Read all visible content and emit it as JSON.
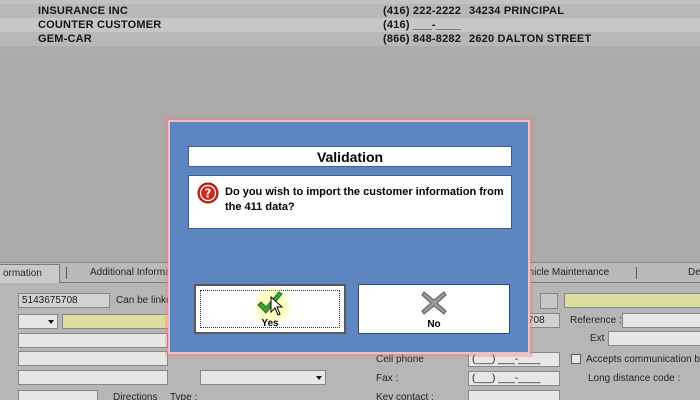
{
  "customer_list": [
    {
      "name": "INSURANCE INC",
      "phone": "(416) 222-2222",
      "address": "34234 PRINCIPAL"
    },
    {
      "name": "COUNTER CUSTOMER",
      "phone": "(416) ___-____",
      "address": ""
    },
    {
      "name": "GEM-CAR",
      "phone": "(866) 848-8282",
      "address": "2620 DALTON STREET"
    }
  ],
  "tabs": [
    {
      "label": "ormation",
      "active": true
    },
    {
      "label": "Additional Informati"
    },
    {
      "label": "ehicle Maintenance"
    },
    {
      "label": "De"
    }
  ],
  "form": {
    "phone_value": "5143675708",
    "can_be_linked_label": "Can be linked",
    "phone2_value": "708",
    "reference_label": "Reference :",
    "ext_label": "Ext :",
    "cell_phone_label": "Cell phone",
    "cell_phone_value": "(___) ___-____",
    "fax_label": "Fax :",
    "fax_value": "(___) ___-____",
    "key_contact_label": "Key contact :",
    "accepts_comm_label": "Accepts communication by",
    "long_distance_label": "Long distance code :",
    "directions_label": "Directions",
    "type_label": "Type :"
  },
  "dialog": {
    "title": "Validation",
    "message": "Do you wish to import the customer information from the 411 data?",
    "yes_label": "Yes",
    "no_label": "No"
  },
  "colors": {
    "dialog_bg": "#5d85c0",
    "yes_check": "#3aa635",
    "no_x": "#8c8c8c",
    "question_icon": "#d9261c"
  }
}
